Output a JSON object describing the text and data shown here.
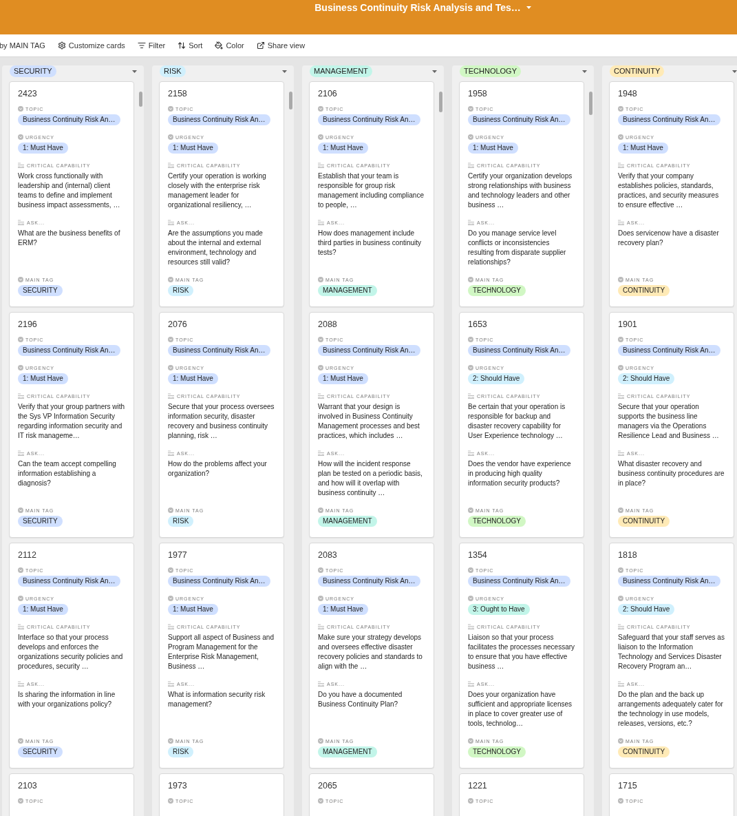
{
  "header": {
    "title": "Business Continuity Risk Analysis and Tes…"
  },
  "toolbar": [
    {
      "kind": "text",
      "label": "by MAIN TAG"
    },
    {
      "kind": "customize",
      "label": "Customize cards"
    },
    {
      "kind": "filter",
      "label": "Filter"
    },
    {
      "kind": "sort",
      "label": "Sort"
    },
    {
      "kind": "color",
      "label": "Color"
    },
    {
      "kind": "share",
      "label": "Share view"
    }
  ],
  "columns": [
    {
      "label": "SECURITY",
      "color": "#cfdfff",
      "cards": [
        {
          "number": "2423",
          "fields": [
            {
              "kind": "select",
              "label": "TOPIC",
              "value": "Business Continuity Risk An…",
              "color": "#cfdfff"
            },
            {
              "kind": "select",
              "label": "URGENCY",
              "value": "1: Must Have",
              "color": "#cfdfff"
            },
            {
              "kind": "text",
              "label": "CRITICAL CAPABILITY",
              "value": "Work cross functionally with leadership and (internal) client teams to define and implement business impact assessments, …"
            },
            {
              "kind": "text",
              "label": "ASK...",
              "value": "What are the business benefits of ERM?"
            },
            {
              "kind": "select",
              "label": "MAIN TAG",
              "value": "SECURITY",
              "color": "#cfdfff"
            }
          ]
        },
        {
          "number": "2196",
          "fields": [
            {
              "kind": "select",
              "label": "TOPIC",
              "value": "Business Continuity Risk An…",
              "color": "#cfdfff"
            },
            {
              "kind": "select",
              "label": "URGENCY",
              "value": "1: Must Have",
              "color": "#cfdfff"
            },
            {
              "kind": "text",
              "label": "CRITICAL CAPABILITY",
              "value": "Verify that your group partners with the Sys VP Information Security regarding information security and IT risk manageme…"
            },
            {
              "kind": "text",
              "label": "ASK...",
              "value": "Can the team accept compelling information establishing a diagnosis?"
            },
            {
              "kind": "select",
              "label": "MAIN TAG",
              "value": "SECURITY",
              "color": "#cfdfff"
            }
          ]
        },
        {
          "number": "2112",
          "fields": [
            {
              "kind": "select",
              "label": "TOPIC",
              "value": "Business Continuity Risk An…",
              "color": "#cfdfff"
            },
            {
              "kind": "select",
              "label": "URGENCY",
              "value": "1: Must Have",
              "color": "#cfdfff"
            },
            {
              "kind": "text",
              "label": "CRITICAL CAPABILITY",
              "value": "Interface so that your process develops and enforces the organizations security policies and procedures, security …"
            },
            {
              "kind": "text",
              "label": "ASK...",
              "value": "Is sharing the information in line with your organizations policy?"
            },
            {
              "kind": "select",
              "label": "MAIN TAG",
              "value": "SECURITY",
              "color": "#cfdfff"
            }
          ]
        },
        {
          "number": "2103",
          "fields": [
            {
              "kind": "select",
              "label": "TOPIC"
            }
          ]
        }
      ]
    },
    {
      "label": "RISK",
      "color": "#d0f0fd",
      "cards": [
        {
          "number": "2158",
          "fields": [
            {
              "kind": "select",
              "label": "TOPIC",
              "value": "Business Continuity Risk An…",
              "color": "#cfdfff"
            },
            {
              "kind": "select",
              "label": "URGENCY",
              "value": "1: Must Have",
              "color": "#cfdfff"
            },
            {
              "kind": "text",
              "label": "CRITICAL CAPABILITY",
              "value": "Certify your operation is working closely with the enterprise risk management leader for organizational resiliency, …"
            },
            {
              "kind": "text",
              "label": "ASK...",
              "value": "Are the assumptions you made about the internal and external environment, technology and resources still valid?"
            },
            {
              "kind": "select",
              "label": "MAIN TAG",
              "value": "RISK",
              "color": "#d0f0fd"
            }
          ]
        },
        {
          "number": "2076",
          "fields": [
            {
              "kind": "select",
              "label": "TOPIC",
              "value": "Business Continuity Risk An…",
              "color": "#cfdfff"
            },
            {
              "kind": "select",
              "label": "URGENCY",
              "value": "1: Must Have",
              "color": "#cfdfff"
            },
            {
              "kind": "text",
              "label": "CRITICAL CAPABILITY",
              "value": "Secure that your process oversees information security, disaster recovery and business continuity planning, risk …"
            },
            {
              "kind": "text",
              "label": "ASK...",
              "value": "How do the problems affect your organization?"
            },
            {
              "kind": "select",
              "label": "MAIN TAG",
              "value": "RISK",
              "color": "#d0f0fd"
            }
          ]
        },
        {
          "number": "1977",
          "fields": [
            {
              "kind": "select",
              "label": "TOPIC",
              "value": "Business Continuity Risk An…",
              "color": "#cfdfff"
            },
            {
              "kind": "select",
              "label": "URGENCY",
              "value": "1: Must Have",
              "color": "#cfdfff"
            },
            {
              "kind": "text",
              "label": "CRITICAL CAPABILITY",
              "value": "Support all aspect of Business and Program Management for the Enterprise Risk Management, Business …"
            },
            {
              "kind": "text",
              "label": "ASK...",
              "value": "What is information security risk management?"
            },
            {
              "kind": "select",
              "label": "MAIN TAG",
              "value": "RISK",
              "color": "#d0f0fd"
            }
          ]
        },
        {
          "number": "1973",
          "fields": [
            {
              "kind": "select",
              "label": "TOPIC"
            }
          ]
        }
      ]
    },
    {
      "label": "MANAGEMENT",
      "color": "#c2f5e9",
      "cards": [
        {
          "number": "2106",
          "fields": [
            {
              "kind": "select",
              "label": "TOPIC",
              "value": "Business Continuity Risk An…",
              "color": "#cfdfff"
            },
            {
              "kind": "select",
              "label": "URGENCY",
              "value": "1: Must Have",
              "color": "#cfdfff"
            },
            {
              "kind": "text",
              "label": "CRITICAL CAPABILITY",
              "value": "Establish that your team is responsible for group risk management including compliance to people, …"
            },
            {
              "kind": "text",
              "label": "ASK...",
              "value": "How does management include third parties in business continuity tests?"
            },
            {
              "kind": "select",
              "label": "MAIN TAG",
              "value": "MANAGEMENT",
              "color": "#c2f5e9"
            }
          ]
        },
        {
          "number": "2088",
          "fields": [
            {
              "kind": "select",
              "label": "TOPIC",
              "value": "Business Continuity Risk An…",
              "color": "#cfdfff"
            },
            {
              "kind": "select",
              "label": "URGENCY",
              "value": "1: Must Have",
              "color": "#cfdfff"
            },
            {
              "kind": "text",
              "label": "CRITICAL CAPABILITY",
              "value": "Warrant that your design is involved in Business Continuity Management processes and best practices, which includes …"
            },
            {
              "kind": "text",
              "label": "ASK...",
              "value": "How will the incident response plan be tested on a periodic basis, and how will it overlap with business continuity …"
            },
            {
              "kind": "select",
              "label": "MAIN TAG",
              "value": "MANAGEMENT",
              "color": "#c2f5e9"
            }
          ]
        },
        {
          "number": "2083",
          "fields": [
            {
              "kind": "select",
              "label": "TOPIC",
              "value": "Business Continuity Risk An…",
              "color": "#cfdfff"
            },
            {
              "kind": "select",
              "label": "URGENCY",
              "value": "1: Must Have",
              "color": "#cfdfff"
            },
            {
              "kind": "text",
              "label": "CRITICAL CAPABILITY",
              "value": "Make sure your strategy develops and oversees effective disaster recovery policies and standards to align with the …"
            },
            {
              "kind": "text",
              "label": "ASK...",
              "value": "Do you have a documented Business Continuity Plan?"
            },
            {
              "kind": "select",
              "label": "MAIN TAG",
              "value": "MANAGEMENT",
              "color": "#c2f5e9"
            }
          ]
        },
        {
          "number": "2065",
          "fields": [
            {
              "kind": "select",
              "label": "TOPIC"
            }
          ]
        }
      ]
    },
    {
      "label": "TECHNOLOGY",
      "color": "#d1f7c4",
      "cards": [
        {
          "number": "1958",
          "fields": [
            {
              "kind": "select",
              "label": "TOPIC",
              "value": "Business Continuity Risk An…",
              "color": "#cfdfff"
            },
            {
              "kind": "select",
              "label": "URGENCY",
              "value": "1: Must Have",
              "color": "#cfdfff"
            },
            {
              "kind": "text",
              "label": "CRITICAL CAPABILITY",
              "value": "Certify your organization develops strong relationships with business and technology leaders and other business …"
            },
            {
              "kind": "text",
              "label": "ASK...",
              "value": "Do you manage service level conflicts or inconsistencies resulting from disparate supplier relationships?"
            },
            {
              "kind": "select",
              "label": "MAIN TAG",
              "value": "TECHNOLOGY",
              "color": "#d1f7c4"
            }
          ]
        },
        {
          "number": "1653",
          "fields": [
            {
              "kind": "select",
              "label": "TOPIC",
              "value": "Business Continuity Risk An…",
              "color": "#cfdfff"
            },
            {
              "kind": "select",
              "label": "URGENCY",
              "value": "2: Should Have",
              "color": "#d0f0fd"
            },
            {
              "kind": "text",
              "label": "CRITICAL CAPABILITY",
              "value": "Be certain that your operation is responsible for backup and disaster recovery capability for User Experience technology …"
            },
            {
              "kind": "text",
              "label": "ASK...",
              "value": "Does the vendor have experience in producing high quality information security products?"
            },
            {
              "kind": "select",
              "label": "MAIN TAG",
              "value": "TECHNOLOGY",
              "color": "#d1f7c4"
            }
          ]
        },
        {
          "number": "1354",
          "fields": [
            {
              "kind": "select",
              "label": "TOPIC",
              "value": "Business Continuity Risk An…",
              "color": "#cfdfff"
            },
            {
              "kind": "select",
              "label": "URGENCY",
              "value": "3: Ought to Have",
              "color": "#c2f5e9"
            },
            {
              "kind": "text",
              "label": "CRITICAL CAPABILITY",
              "value": "Liaison so that your process facilitates the processes necessary to ensure that you have effective business …"
            },
            {
              "kind": "text",
              "label": "ASK...",
              "value": "Does your organization have sufficient and appropriate licenses in place to cover greater use of tools, technolog…"
            },
            {
              "kind": "select",
              "label": "MAIN TAG",
              "value": "TECHNOLOGY",
              "color": "#d1f7c4"
            }
          ]
        },
        {
          "number": "1221",
          "fields": [
            {
              "kind": "select",
              "label": "TOPIC"
            }
          ]
        }
      ]
    },
    {
      "label": "CONTINUITY",
      "color": "#ffeab6",
      "cards": [
        {
          "number": "1948",
          "fields": [
            {
              "kind": "select",
              "label": "TOPIC",
              "value": "Business Continuity Risk An…",
              "color": "#cfdfff"
            },
            {
              "kind": "select",
              "label": "URGENCY",
              "value": "1: Must Have",
              "color": "#cfdfff"
            },
            {
              "kind": "text",
              "label": "CRITICAL CAPABILITY",
              "value": "Verify that your company establishes policies, standards, practices, and security measures to ensure effective …"
            },
            {
              "kind": "text",
              "label": "ASK...",
              "value": "Does servicenow have a disaster recovery plan?"
            },
            {
              "kind": "select",
              "label": "MAIN TAG",
              "value": "CONTINUITY",
              "color": "#ffeab6"
            }
          ]
        },
        {
          "number": "1901",
          "fields": [
            {
              "kind": "select",
              "label": "TOPIC",
              "value": "Business Continuity Risk An…",
              "color": "#cfdfff"
            },
            {
              "kind": "select",
              "label": "URGENCY",
              "value": "2: Should Have",
              "color": "#d0f0fd"
            },
            {
              "kind": "text",
              "label": "CRITICAL CAPABILITY",
              "value": "Secure that your operation supports the business line managers via the Operations Resilience Lead and Business …"
            },
            {
              "kind": "text",
              "label": "ASK...",
              "value": "What disaster recovery and business continuity procedures are in place?"
            },
            {
              "kind": "select",
              "label": "MAIN TAG",
              "value": "CONTINUITY",
              "color": "#ffeab6"
            }
          ]
        },
        {
          "number": "1818",
          "fields": [
            {
              "kind": "select",
              "label": "TOPIC",
              "value": "Business Continuity Risk An…",
              "color": "#cfdfff"
            },
            {
              "kind": "select",
              "label": "URGENCY",
              "value": "2: Should Have",
              "color": "#d0f0fd"
            },
            {
              "kind": "text",
              "label": "CRITICAL CAPABILITY",
              "value": "Safeguard that your staff serves as liaison to the Information Technology and Services Disaster Recovery Program an…"
            },
            {
              "kind": "text",
              "label": "ASK...",
              "value": "Do the plan and the back up arrangements adequately cater for the technology in use models, releases, versions, etc.?"
            },
            {
              "kind": "select",
              "label": "MAIN TAG",
              "value": "CONTINUITY",
              "color": "#ffeab6"
            }
          ]
        },
        {
          "number": "1715",
          "fields": [
            {
              "kind": "select",
              "label": "TOPIC"
            }
          ]
        }
      ]
    }
  ]
}
